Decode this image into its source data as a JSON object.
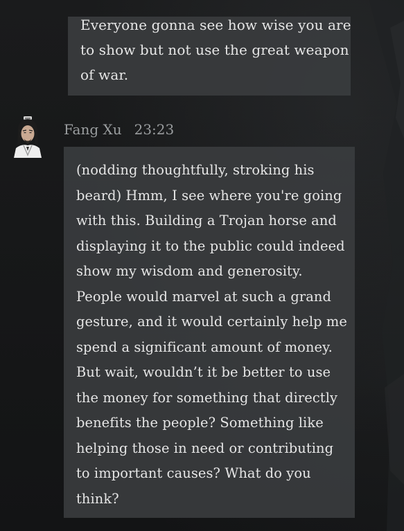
{
  "previous_message": {
    "lines": [
      "Everyone gonna see how wise you are",
      "to show but not use the great weapon",
      "of war."
    ]
  },
  "message": {
    "sender": "Fang Xu",
    "time": "23:23",
    "avatar_icon": "character-portrait-icon",
    "lines": [
      "(nodding thoughtfully, stroking his",
      "beard) Hmm, I see where you're going",
      "with this. Building a Trojan horse and",
      "displaying it to the public could indeed",
      "show my wisdom and generosity.",
      "People would marvel at such a grand",
      "gesture, and it would certainly help me",
      "spend a significant amount of money.",
      "But wait, wouldn’t it be better to use",
      "the money for something that directly",
      "benefits the people? Something like",
      "helping those in need or contributing",
      "to important causes? What do you",
      "think?"
    ]
  },
  "colors": {
    "background": "#151617",
    "bubble": "#3a3c3e",
    "text": "#e6e6e6",
    "meta_text": "#9a9d9f"
  }
}
